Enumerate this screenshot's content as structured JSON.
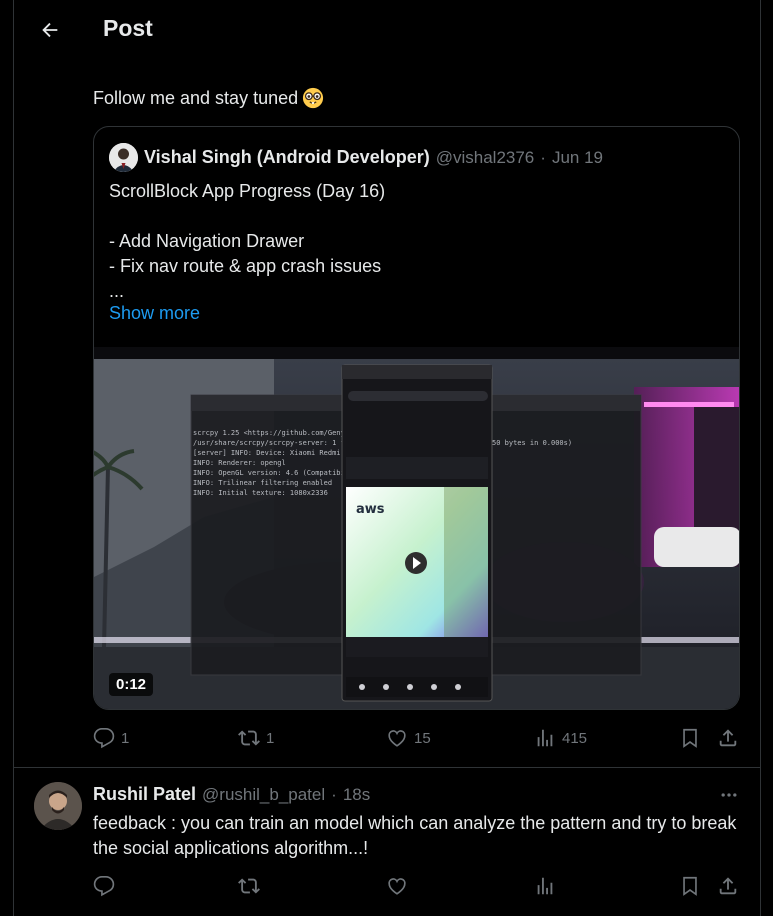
{
  "header": {
    "title": "Post"
  },
  "post": {
    "text": "Follow me and stay tuned",
    "emoji": "nerd-face-emoji"
  },
  "quote": {
    "author_name": "Vishal Singh (Android Developer)",
    "author_handle": "@vishal2376",
    "dot": "·",
    "date": "Jun 19",
    "lines": [
      "ScrollBlock App Progress (Day 16)",
      "",
      "- Add Navigation Drawer",
      "- Fix nav route & app crash issues",
      "..."
    ],
    "show_more": "Show more",
    "video_duration": "0:12"
  },
  "post_actions": {
    "replies": "1",
    "reposts": "1",
    "likes": "15",
    "views": "415"
  },
  "reply": {
    "author_name": "Rushil Patel",
    "author_handle": "@rushil_b_patel",
    "dot": "·",
    "time": "18s",
    "text": "feedback : you can train an model which can analyze the pattern and try to break the social applications algorithm...!"
  },
  "colors": {
    "background": "#000000",
    "text_primary": "#e7e9ea",
    "text_secondary": "#71767b",
    "link": "#1d9bf0",
    "border": "#2f3336"
  }
}
